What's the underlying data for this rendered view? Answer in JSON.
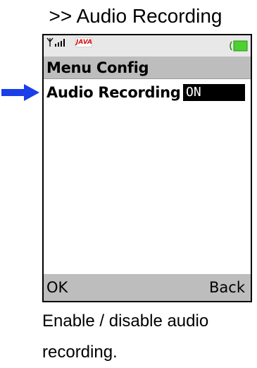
{
  "caption": {
    "title": ">> Audio Recording",
    "description_line1": "Enable / disable audio",
    "description_line2": "recording."
  },
  "status_bar": {
    "signal_icon": "signal-strength-icon",
    "java_label": "JAVA",
    "battery_icon": "battery-icon"
  },
  "menu": {
    "title": "Menu Config",
    "row_label": "Audio Recording",
    "row_indicator": "✦",
    "row_value": "ON"
  },
  "softkeys": {
    "left": "OK",
    "right": "Back"
  },
  "colors": {
    "pointer_arrow": "#1a3ee8",
    "battery_fill": "#4cd12e",
    "header_bg": "#bdbdbd",
    "java_text": "#d31212"
  }
}
